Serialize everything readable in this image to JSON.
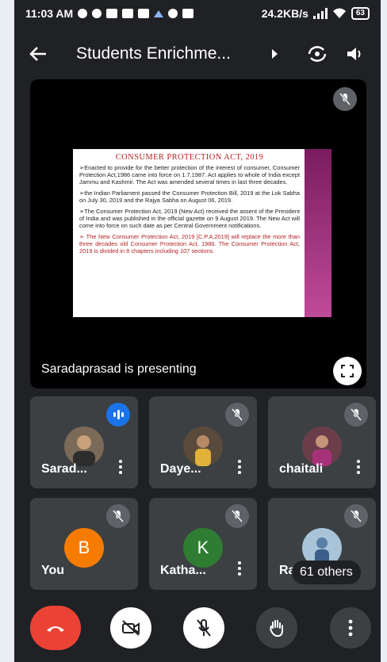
{
  "status_bar": {
    "time": "11:03 AM",
    "network_speed": "24.2KB/s",
    "battery": "63",
    "accent_color": "#8ab4f8"
  },
  "header": {
    "title": "Students Enrichme...",
    "icons": [
      "back-arrow-icon",
      "chevron-right-icon",
      "switch-camera-icon",
      "speaker-icon"
    ]
  },
  "presentation": {
    "presenter_label": "Saradaprasad is presenting",
    "slide": {
      "title": "CONSUMER PROTECTION ACT, 2019",
      "paragraphs": [
        "➢Enacted to provide for the better protection of the interest of consumer, Consumer Protection Act,1986 came into force on 1.7.1987. Act applies to whole of India except Jammu and Kashmir. The Act was amended several times in last three decades.",
        "➢the Indian Parliament passed the Consumer Protection Bill, 2019 at the Lok Sabha on July 30, 2019 and the Rajya Sabha on August 06, 2019.",
        "➢The Consumer Protection Act, 2019 (New Act) received the assent of the President of India and was published in the official gazette on 9 August 2019. The New Act will come into force on such date as per Central Government notifications."
      ],
      "highlight_paragraph": "➢ The New Consumer Protection Act, 2019 [C.P.A,2019] will replace the more than three decades old Consumer Protection Act, 1986. The Consumer Protection Act, 2019 is divided in 8 chapters including 107 sections."
    }
  },
  "participants": [
    {
      "name": "Sarad...",
      "avatar_type": "photo",
      "speaking": true,
      "muted": false
    },
    {
      "name": "Daye...",
      "avatar_type": "photo",
      "speaking": false,
      "muted": true
    },
    {
      "name": "chaitali",
      "avatar_type": "photo",
      "speaking": false,
      "muted": true
    },
    {
      "name": "You",
      "avatar_letter": "B",
      "avatar_color": "#f57c00",
      "speaking": false,
      "muted": true
    },
    {
      "name": "Katha...",
      "avatar_letter": "K",
      "avatar_color": "#2e7d32",
      "speaking": false,
      "muted": true
    },
    {
      "name": "Ra",
      "avatar_type": "photo",
      "speaking": false,
      "muted": true,
      "others_label": "61 others"
    }
  ],
  "controls": {
    "end_call_color": "#ea4335",
    "buttons": [
      "end-call-icon",
      "camera-off-icon",
      "mic-off-icon",
      "raise-hand-icon",
      "more-options-icon"
    ]
  }
}
